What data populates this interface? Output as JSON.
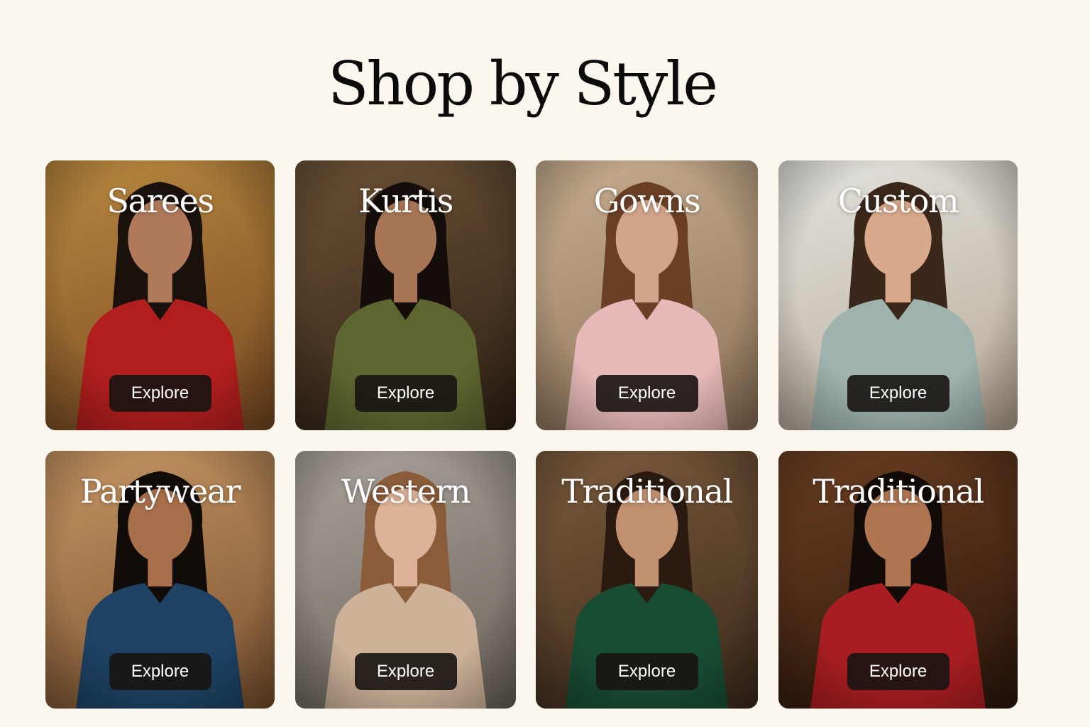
{
  "page": {
    "title": "Shop by Style"
  },
  "cards": [
    {
      "label": "Sarees",
      "button": "Explore",
      "theme": [
        "#b9873f",
        "#7a4a22"
      ],
      "outfit": "#b21e1e",
      "skin": "#b07a5a",
      "hair": "#1a110c"
    },
    {
      "label": "Kurtis",
      "button": "Explore",
      "theme": [
        "#6b5136",
        "#2f2115"
      ],
      "outfit": "#5d6630",
      "skin": "#a87656",
      "hair": "#140d09"
    },
    {
      "label": "Gowns",
      "button": "Explore",
      "theme": [
        "#c7ad8f",
        "#8d7359"
      ],
      "outfit": "#e6b9b8",
      "skin": "#d2a48a",
      "hair": "#6a3f26"
    },
    {
      "label": "Custom",
      "button": "Explore",
      "theme": [
        "#e3e3df",
        "#b8aa96"
      ],
      "outfit": "#9fb3ae",
      "skin": "#d8a98c",
      "hair": "#3a2719"
    },
    {
      "label": "Partywear",
      "button": "Explore",
      "theme": [
        "#c59462",
        "#7a5230"
      ],
      "outfit": "#1d4263",
      "skin": "#a86f4b",
      "hair": "#120c08"
    },
    {
      "label": "Western",
      "button": "Explore",
      "theme": [
        "#a9a29a",
        "#6d655c"
      ],
      "outfit": "#cdb299",
      "skin": "#dcb398",
      "hair": "#8a5c3a"
    },
    {
      "label": "Traditional",
      "button": "Explore",
      "theme": [
        "#7a5a3c",
        "#3e2b1c"
      ],
      "outfit": "#184c33",
      "skin": "#c1916f",
      "hair": "#2a1a10"
    },
    {
      "label": "Traditional",
      "button": "Explore",
      "theme": [
        "#6a3e22",
        "#2d170b"
      ],
      "outfit": "#a81d22",
      "skin": "#b07652",
      "hair": "#120b07"
    }
  ]
}
